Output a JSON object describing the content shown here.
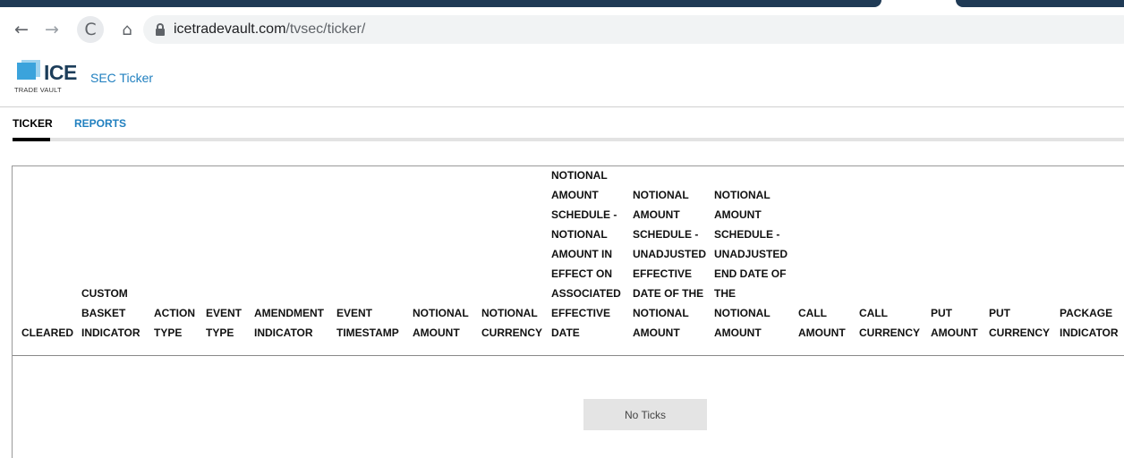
{
  "browser": {
    "nav": {
      "back_glyph": "←",
      "forward_glyph": "→",
      "reload_glyph": "C",
      "home_glyph": "⌂"
    },
    "url_host": "icetradevault.com",
    "url_path": "/tvsec/ticker/"
  },
  "header": {
    "logo_text": "ICE",
    "logo_subtext": "TRADE VAULT",
    "app_name": "SEC Ticker"
  },
  "tabs": [
    {
      "label": "TICKER",
      "active": true
    },
    {
      "label": "REPORTS",
      "active": false
    }
  ],
  "table": {
    "columns": [
      "CLEARED",
      "CUSTOM\nBASKET\nINDICATOR",
      "ACTION\nTYPE",
      "EVENT\nTYPE",
      "AMENDMENT\nINDICATOR",
      "EVENT\nTIMESTAMP",
      "NOTIONAL\nAMOUNT",
      "NOTIONAL\nCURRENCY",
      "NOTIONAL\nAMOUNT\nSCHEDULE -\nNOTIONAL\nAMOUNT IN\nEFFECT ON\nASSOCIATED\nEFFECTIVE\nDATE",
      "NOTIONAL\nAMOUNT\nSCHEDULE -\nUNADJUSTED\nEFFECTIVE\nDATE OF THE\nNOTIONAL\nAMOUNT",
      "NOTIONAL\nAMOUNT\nSCHEDULE -\nUNADJUSTED\nEND DATE OF\nTHE\nNOTIONAL\nAMOUNT",
      "CALL\nAMOUNT",
      "CALL\nCURRENCY",
      "PUT\nAMOUNT",
      "PUT\nCURRENCY",
      "PACKAGE\nINDICATOR"
    ],
    "empty_message": "No Ticks"
  },
  "colors": {
    "accent": "#1f7fbf",
    "brand_dark": "#1c3d5a",
    "brand_light": "#3ba3dc"
  }
}
